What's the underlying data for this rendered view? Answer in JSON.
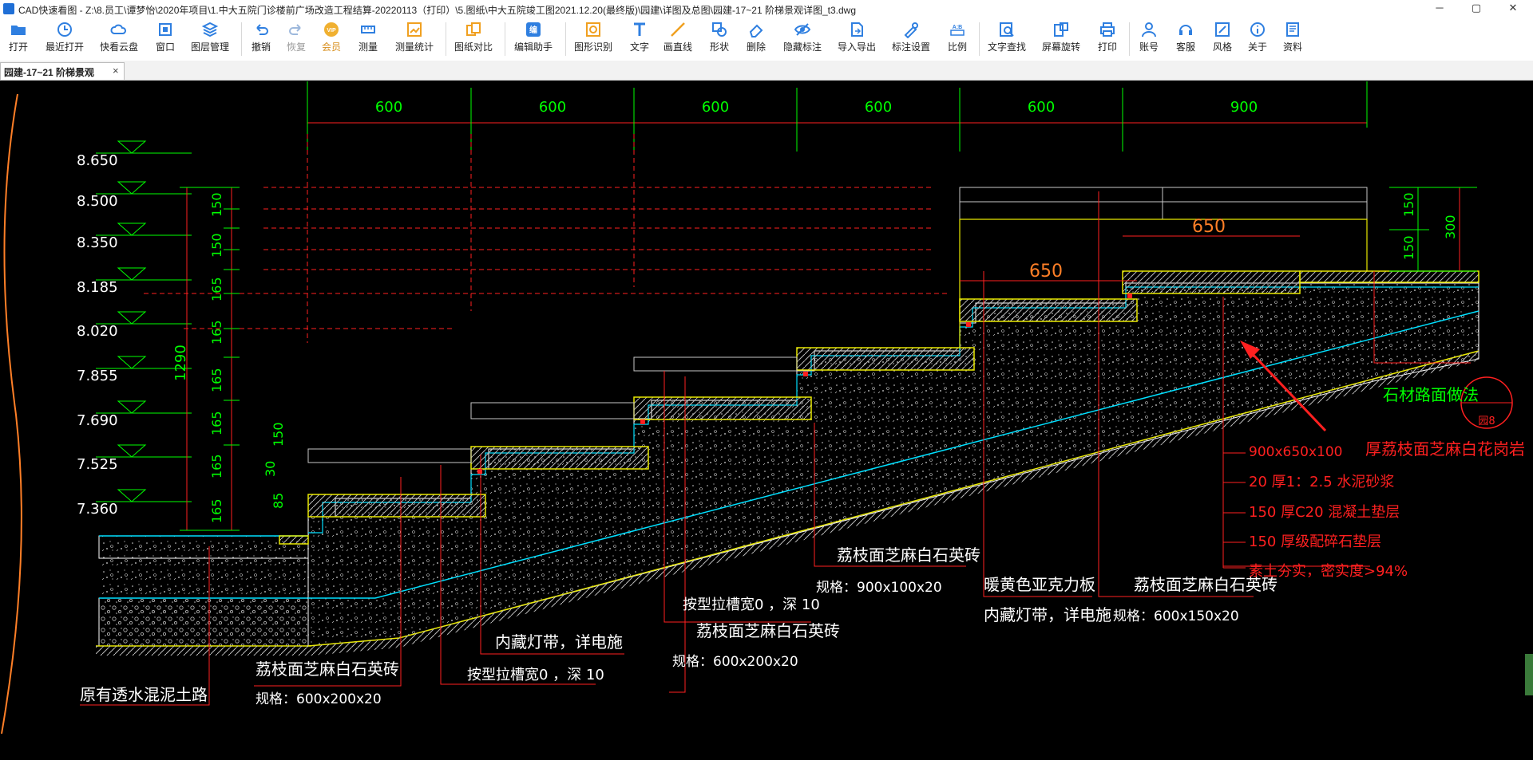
{
  "window": {
    "title": "CAD快速看图 - Z:\\8.员工\\谭梦怡\\2020年项目\\1.中大五院门诊楼前广场改造工程结算-20220113（打印）\\5.图纸\\中大五院竣工图2021.12.20(最终版)\\园建\\详图及总图\\园建-17~21 阶梯景观详图_t3.dwg",
    "minimize": "─",
    "maximize": "▢",
    "close": "✕"
  },
  "toolbar": {
    "open": "打开",
    "recent": "最近打开",
    "cloud": "快看云盘",
    "window": "窗口",
    "layers": "图层管理",
    "undo": "撤销",
    "redo": "恢复",
    "vip": "会员",
    "measure": "测量",
    "measure_stats": "测量统计",
    "compare": "图纸对比",
    "edit_helper": "编辑助手",
    "shape_recognize": "图形识别",
    "text": "文字",
    "line": "画直线",
    "shape": "形状",
    "delete": "删除",
    "hide_annot": "隐藏标注",
    "import_export": "导入导出",
    "annot_settings": "标注设置",
    "scale": "比例",
    "text_search": "文字查找",
    "rotate": "屏幕旋转",
    "print": "打印",
    "account": "账号",
    "service": "客服",
    "style": "风格",
    "about": "关于",
    "resources": "资料"
  },
  "tab": {
    "label": "园建-17~21 阶梯景观",
    "close": "×"
  },
  "drawing": {
    "top_dims": [
      "600",
      "600",
      "600",
      "600",
      "600",
      "900"
    ],
    "elevations": [
      "8.650",
      "8.500",
      "8.350",
      "8.185",
      "8.020",
      "7.855",
      "7.690",
      "7.525",
      "7.360"
    ],
    "vdims": [
      "150",
      "150",
      "165",
      "165",
      "165",
      "165",
      "165",
      "165"
    ],
    "total_dim": "1290",
    "small_dims": [
      "150",
      "30",
      "85"
    ],
    "right_dims": [
      "150",
      "150",
      "300"
    ],
    "width_650a": "650",
    "width_650b": "650",
    "labels": {
      "existing_road": "原有透水混泥土路",
      "brick1": "荔枝面芝麻白石英砖",
      "spec1": "规格：600x200x20",
      "groove1": "按型拉槽宽0 ，深 10",
      "lightstrip1": "内藏灯带，详电施",
      "groove2": "按型拉槽宽0 ，深 10",
      "brick2": "荔枝面芝麻白石英砖",
      "spec2": "规格：600x200x20",
      "brick3": "荔枝面芝麻白石英砖",
      "spec3": "规格：900x100x20",
      "acrylic": "暖黄色亚克力板",
      "lightstrip2": "内藏灯带，详电施",
      "brick4": "荔枝面芝麻白石英砖",
      "spec4": "规格：600x150x20",
      "stone_method": "石材路面做法",
      "detail_ref": "园8",
      "layer1": "900x650x100",
      "layer1_desc": "厚荔枝面芝麻白花岗岩",
      "layer2": "20 厚1：2.5 水泥砂浆",
      "layer3": "150 厚C20 混凝土垫层",
      "layer4": "150 厚级配碎石垫层",
      "layer5": "素土夯实，密实度>94%"
    },
    "colors": {
      "bg": "#000000",
      "dim_green": "#00ff00",
      "red": "#ff2020",
      "yellow": "#e8e800",
      "cyan": "#00e0ff",
      "white": "#ffffff",
      "grey": "#c8c8c8"
    }
  }
}
